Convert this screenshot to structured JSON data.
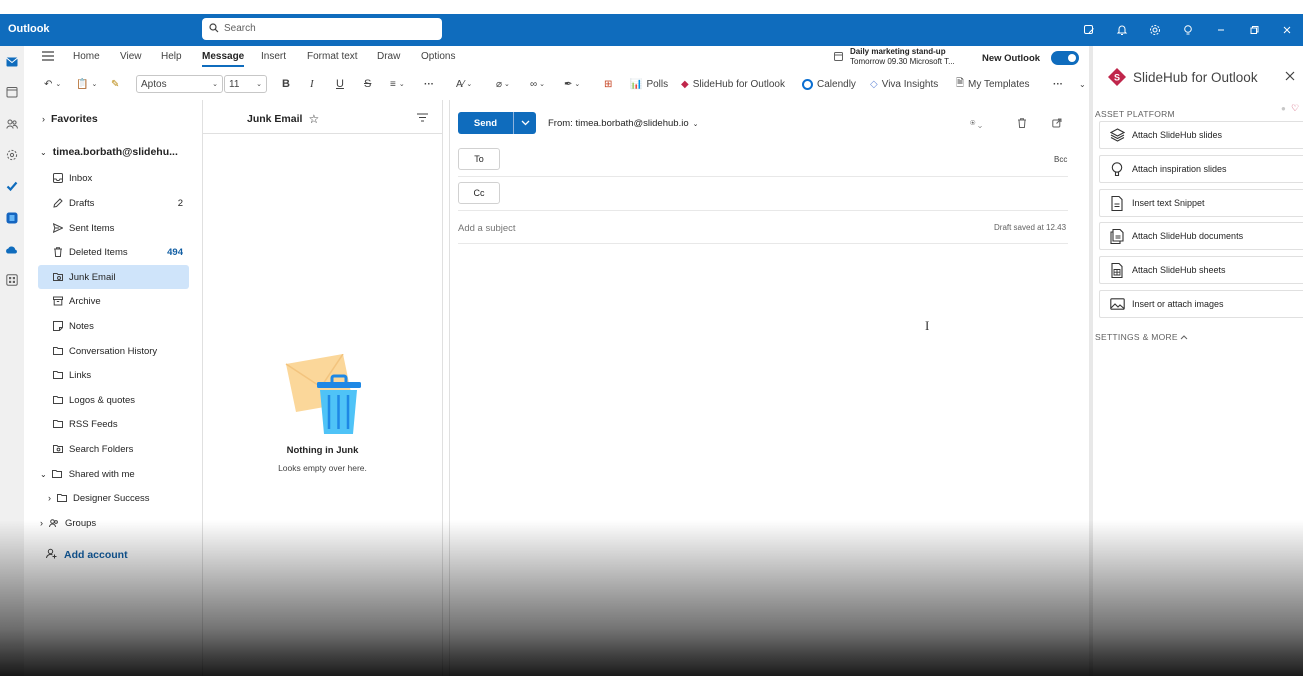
{
  "app": {
    "title": "Outlook",
    "search_placeholder": "Search",
    "brand_color": "#0f6cbd"
  },
  "ribbon": {
    "tabs": [
      "Home",
      "View",
      "Help",
      "Message",
      "Insert",
      "Format text",
      "Draw",
      "Options"
    ],
    "active_tab": "Message",
    "meeting": {
      "title": "Daily marketing stand-up",
      "when": "Tomorrow 09.30 Microsoft T..."
    },
    "new_outlook_label": "New Outlook",
    "font_name": "Aptos",
    "font_size": "11",
    "polls": "Polls",
    "slidehub": "SlideHub for Outlook",
    "calendly": "Calendly",
    "viva": "Viva Insights",
    "templates": "My Templates",
    "more": "···"
  },
  "folders": {
    "favorites": "Favorites",
    "account": "timea.borbath@slidehu...",
    "items": [
      {
        "label": "Inbox",
        "icon": "inbox-icon",
        "count": ""
      },
      {
        "label": "Drafts",
        "icon": "pencil-icon",
        "count": "2"
      },
      {
        "label": "Sent Items",
        "icon": "send-icon",
        "count": ""
      },
      {
        "label": "Deleted Items",
        "icon": "trash-icon",
        "count": "494"
      },
      {
        "label": "Junk Email",
        "icon": "junk-icon",
        "count": ""
      },
      {
        "label": "Archive",
        "icon": "archive-icon",
        "count": ""
      },
      {
        "label": "Notes",
        "icon": "note-icon",
        "count": ""
      },
      {
        "label": "Conversation History",
        "icon": "folder-icon",
        "count": ""
      },
      {
        "label": "Links",
        "icon": "folder-icon",
        "count": ""
      },
      {
        "label": "Logos & quotes",
        "icon": "folder-icon",
        "count": ""
      },
      {
        "label": "RSS Feeds",
        "icon": "folder-icon",
        "count": ""
      },
      {
        "label": "Search Folders",
        "icon": "search-folder-icon",
        "count": ""
      }
    ],
    "shared": "Shared with me",
    "designer": "Designer Success",
    "groups": "Groups",
    "add_account": "Add account"
  },
  "list": {
    "title": "Junk Email",
    "empty_title": "Nothing in Junk",
    "empty_sub": "Looks empty over here."
  },
  "compose": {
    "send": "Send",
    "from": "From: timea.borbath@slidehub.io",
    "to": "To",
    "cc": "Cc",
    "bcc": "Bcc",
    "subject_placeholder": "Add a subject",
    "draft_status": "Draft saved at 12.43"
  },
  "addin": {
    "title": "SlideHub for Outlook",
    "section": "ASSET PLATFORM",
    "items": [
      {
        "label": "Attach SlideHub slides",
        "icon": "layers-icon"
      },
      {
        "label": "Attach inspiration slides",
        "icon": "lightbulb-icon"
      },
      {
        "label": "Insert text Snippet",
        "icon": "document-icon"
      },
      {
        "label": "Attach SlideHub documents",
        "icon": "documents-icon"
      },
      {
        "label": "Attach SlideHub sheets",
        "icon": "sheet-icon"
      },
      {
        "label": "Insert or attach images",
        "icon": "image-icon"
      }
    ],
    "settings": "SETTINGS & MORE"
  }
}
